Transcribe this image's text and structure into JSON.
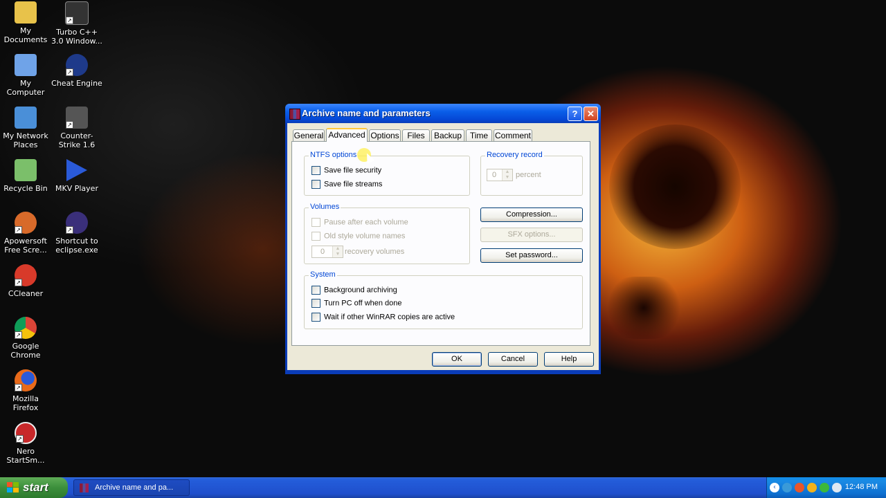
{
  "desktop": {
    "icons": [
      {
        "label": "My Documents",
        "color": "#e8c24a"
      },
      {
        "label": "Turbo C++ 3.0 Window...",
        "color": "#333333"
      },
      {
        "label": "My Computer",
        "color": "#6fa3e8"
      },
      {
        "label": "Cheat Engine",
        "color": "#1e3a8a"
      },
      {
        "label": "My Network Places",
        "color": "#4a8fd8"
      },
      {
        "label": "Counter-Strike 1.6",
        "color": "#555555"
      },
      {
        "label": "Recycle Bin",
        "color": "#7bbf6a"
      },
      {
        "label": "MKV Player",
        "color": "#2a5ad8"
      },
      {
        "label": "Apowersoft Free Scre...",
        "color": "#d86a2a"
      },
      {
        "label": "Shortcut to eclipse.exe",
        "color": "#3a2f7a"
      },
      {
        "label": "CCleaner",
        "color": "#d83a2a"
      },
      {
        "label": "Google Chrome",
        "color": "#e8b22a"
      },
      {
        "label": "Mozilla Firefox",
        "color": "#e86a1a"
      },
      {
        "label": "Nero StartSm...",
        "color": "#c8282a"
      }
    ]
  },
  "dialog": {
    "title": "Archive name and parameters",
    "help_btn": "?",
    "close_btn": "✕",
    "tabs": [
      "General",
      "Advanced",
      "Options",
      "Files",
      "Backup",
      "Time",
      "Comment"
    ],
    "active_tab": "Advanced",
    "ntfs": {
      "title": "NTFS options",
      "save_security": "Save file security",
      "save_streams": "Save file streams"
    },
    "recovery": {
      "title": "Recovery record",
      "value": "0",
      "unit": "percent"
    },
    "volumes": {
      "title": "Volumes",
      "pause": "Pause after each volume",
      "old_style": "Old style volume names",
      "value": "0",
      "unit": "recovery volumes"
    },
    "buttons": {
      "compression": "Compression...",
      "sfx": "SFX options...",
      "password": "Set password...",
      "ok": "OK",
      "cancel": "Cancel",
      "help": "Help"
    },
    "system": {
      "title": "System",
      "background": "Background archiving",
      "turn_off": "Turn PC off when done",
      "wait": "Wait if other WinRAR copies are active"
    }
  },
  "taskbar": {
    "start": "start",
    "task_label": "Archive name and pa...",
    "clock": "12:48 PM",
    "tray_chevron": "‹"
  }
}
